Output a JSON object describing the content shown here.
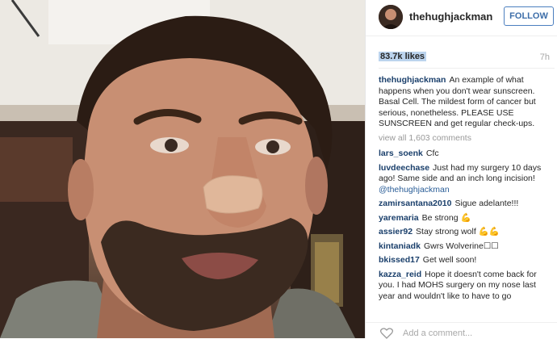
{
  "header": {
    "username": "thehughjackman",
    "follow_label": "FOLLOW",
    "avatar_icon": "avatar-icon"
  },
  "post": {
    "likes": "83.7k likes",
    "age": "7h",
    "caption": {
      "user": "thehughjackman",
      "text": "An example of what happens when you don't wear sunscreen. Basal Cell. The mildest form of cancer but serious, nonetheless. PLEASE USE SUNSCREEN and get regular check-ups."
    },
    "view_all": "view all 1,603 comments",
    "comments": [
      {
        "user": "lars_soenk",
        "text": "Cfc",
        "mention": ""
      },
      {
        "user": "luvdeechase",
        "text": "Just had my surgery 10 days ago! Same side and an inch long incision!",
        "mention": "@thehughjackman"
      },
      {
        "user": "zamirsantana2010",
        "text": "Sigue adelante!!!",
        "mention": ""
      },
      {
        "user": "yaremaria",
        "text": "Be strong 💪",
        "mention": ""
      },
      {
        "user": "assier92",
        "text": "Stay strong wolf 💪💪",
        "mention": ""
      },
      {
        "user": "kintaniadk",
        "text": "Gwrs Wolverine☐☐",
        "mention": ""
      },
      {
        "user": "bkissed17",
        "text": "Get well soon!",
        "mention": ""
      },
      {
        "user": "kazza_reid",
        "text": "Hope it doesn't come back for you. I had MOHS surgery on my nose last year and wouldn't like to have to go",
        "mention": ""
      }
    ],
    "add_comment_placeholder": "Add a comment..."
  },
  "icons": {
    "heart": "heart-icon",
    "avatar": "avatar-icon"
  },
  "colors": {
    "follow_blue": "#3d6ea9",
    "username_dark_blue": "#1a3f6b",
    "likes_highlight": "#bcd4ee"
  }
}
